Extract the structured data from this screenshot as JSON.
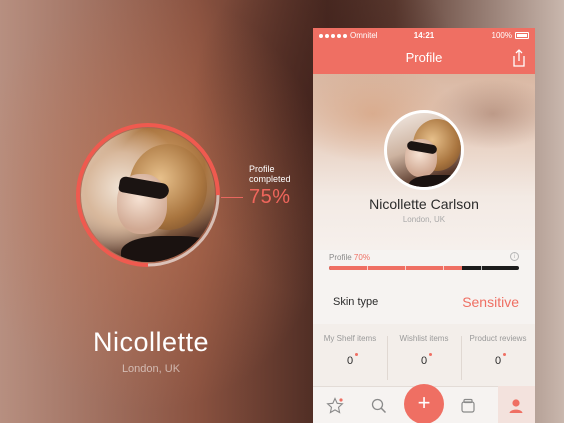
{
  "hero": {
    "completed_label": "Profile completed",
    "completed_value": "75%",
    "completion_fraction": 0.75,
    "name": "Nicollette",
    "location": "London, UK"
  },
  "statusbar": {
    "carrier": "Omnitel",
    "time": "14:21",
    "battery": "100%"
  },
  "navbar": {
    "title": "Profile",
    "share_icon": "share-icon"
  },
  "profile": {
    "name": "Nicollette Carlson",
    "location": "London, UK",
    "progress_label": "Profile",
    "progress_value": "70%",
    "progress_fraction": 0.7,
    "info_icon": "i"
  },
  "skin": {
    "label": "Skin type",
    "value": "Sensitive"
  },
  "stats": [
    {
      "label": "My Shelf items",
      "value": "0"
    },
    {
      "label": "Wishlist items",
      "value": "0"
    },
    {
      "label": "Product reviews",
      "value": "0"
    }
  ],
  "tabbar": {
    "items": [
      "star-icon",
      "search-icon",
      "add-icon",
      "jar-icon",
      "profile-icon"
    ],
    "add_label": "+"
  },
  "colors": {
    "accent": "#ef6f63",
    "text_dark": "#2b2b2b",
    "text_muted": "#a9a9a9"
  }
}
